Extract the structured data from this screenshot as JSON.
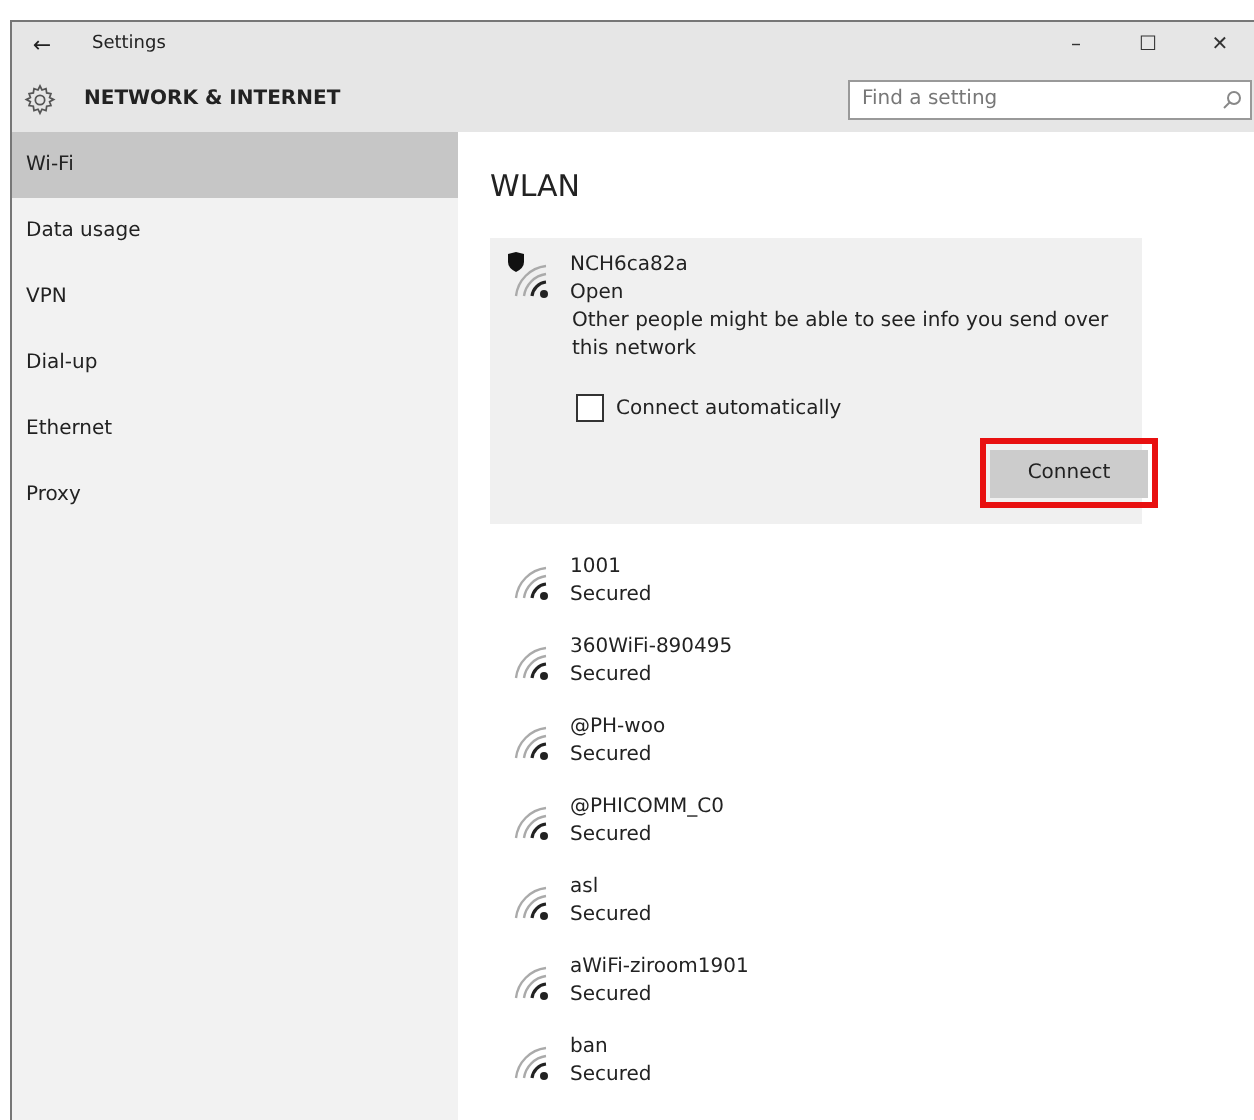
{
  "window": {
    "back": "←",
    "title": "Settings",
    "controls": [
      "–",
      "☐",
      "✕"
    ]
  },
  "header": {
    "title": "NETWORK & INTERNET",
    "search": {
      "placeholder": "Find a setting"
    }
  },
  "sidebar": {
    "items": [
      {
        "label": "Wi-Fi",
        "selected": true
      },
      {
        "label": "Data usage",
        "selected": false
      },
      {
        "label": "VPN",
        "selected": false
      },
      {
        "label": "Dial-up",
        "selected": false
      },
      {
        "label": "Ethernet",
        "selected": false
      },
      {
        "label": "Proxy",
        "selected": false
      }
    ]
  },
  "content": {
    "heading": "WLAN",
    "open_network": {
      "name": "NCH6ca82a",
      "status": "Open",
      "warning": "Other people might be able to see info you send over this network",
      "auto_connect": {
        "label": "Connect automatically",
        "checked": false
      },
      "button": {
        "label": "Connect",
        "highlighted": true
      }
    },
    "networks": [
      {
        "name": "1001",
        "status": "Secured"
      },
      {
        "name": "360WiFi-890495",
        "status": "Secured"
      },
      {
        "name": "@PH-woo",
        "status": "Secured"
      },
      {
        "name": "@PHICOMM_C0",
        "status": "Secured"
      },
      {
        "name": "asl",
        "status": "Secured"
      },
      {
        "name": "aWiFi-ziroom1901",
        "status": "Secured"
      },
      {
        "name": "ban",
        "status": "Secured"
      }
    ]
  }
}
